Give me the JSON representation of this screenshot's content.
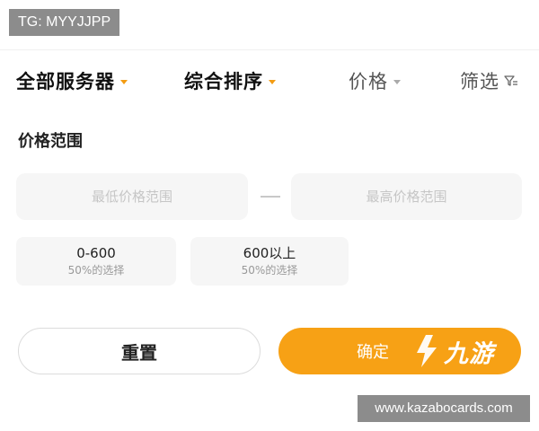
{
  "watermarks": {
    "top_left": "TG: MYYJJPP",
    "bottom_right": "www.kazabocards.com"
  },
  "tabs": [
    {
      "label": "全部服务器",
      "icon": "caret-down-icon"
    },
    {
      "label": "综合排序",
      "icon": "caret-down-icon"
    },
    {
      "label": "价格",
      "icon": "caret-down-icon"
    },
    {
      "label": "筛选",
      "icon": "filter-icon"
    }
  ],
  "price_filter": {
    "title": "价格范围",
    "min_placeholder": "最低价格范围",
    "min_value": "",
    "max_placeholder": "最高价格范围",
    "max_value": "",
    "options": [
      {
        "range": "0-600",
        "share": "50%的选择"
      },
      {
        "range": "600以上",
        "share": "50%的选择"
      }
    ]
  },
  "actions": {
    "reset_label": "重置",
    "confirm_label": "确定"
  },
  "brand": {
    "logo_text": "九游"
  },
  "colors": {
    "accent": "#f7a115",
    "caret": "#f39c12",
    "input_bg": "#f6f6f6",
    "watermark_bg": "#8c8c8c"
  }
}
